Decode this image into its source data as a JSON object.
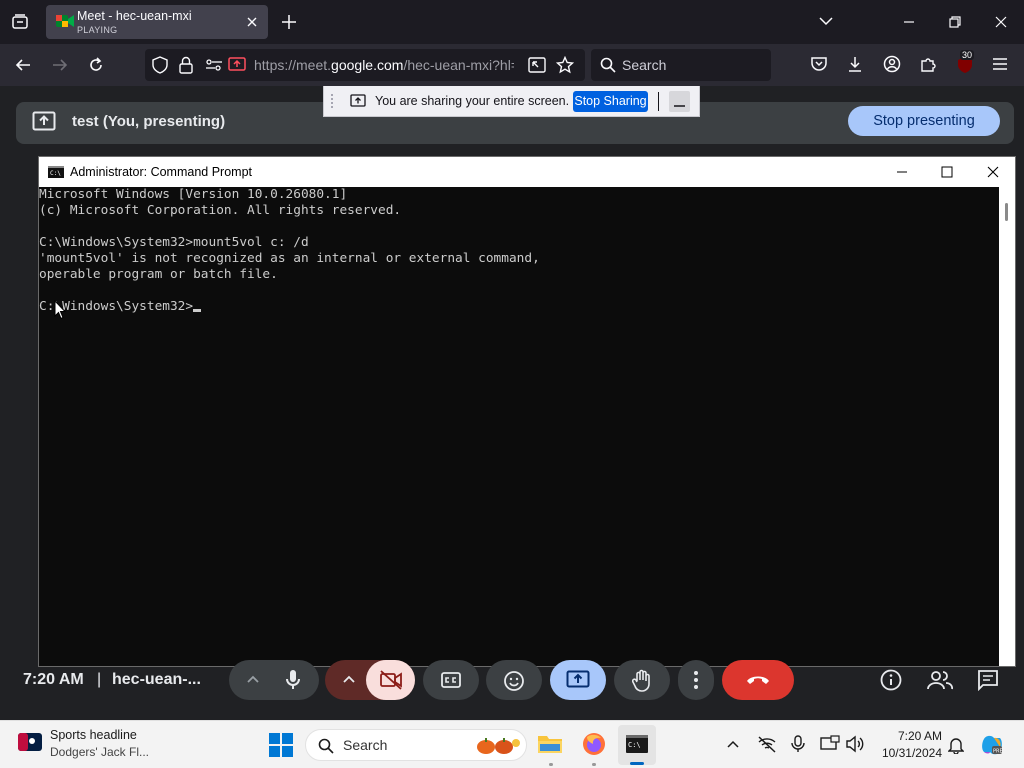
{
  "browser": {
    "tab": {
      "title": "Meet - hec-uean-mxi",
      "status": "PLAYING"
    },
    "url": {
      "prefix": "https://meet.",
      "domain": "google.com",
      "rest": "/hec-uean-mxi?hl="
    },
    "search_placeholder": "Search",
    "extension_badge": "30"
  },
  "sharing_notice": {
    "message": "You are sharing your entire screen.",
    "stop_button": "Stop Sharing"
  },
  "meet": {
    "presenting_label": "test (You, presenting)",
    "stop_presenting_button": "Stop presenting",
    "clock": "7:20 AM",
    "separator": "|",
    "meeting_code": "hec-uean-..."
  },
  "cmd": {
    "title": "Administrator: Command Prompt",
    "lines": [
      "Microsoft Windows [Version 10.0.26080.1]",
      "(c) Microsoft Corporation. All rights reserved.",
      "",
      "C:\\Windows\\System32>mount5vol c: /d",
      "'mount5vol' is not recognized as an internal or external command,",
      "operable program or batch file.",
      "",
      "C:\\Windows\\System32>"
    ]
  },
  "taskbar": {
    "news_title": "Sports headline",
    "news_sub": "Dodgers' Jack Fl...",
    "search_placeholder": "Search",
    "time": "7:20 AM",
    "date": "10/31/2024"
  },
  "colors": {
    "stop_presenting_bg": "#a8c7fa",
    "end_call_red": "#dc362e",
    "share_blue": "#0061e0",
    "present_active_blue": "#a8c7fa"
  }
}
